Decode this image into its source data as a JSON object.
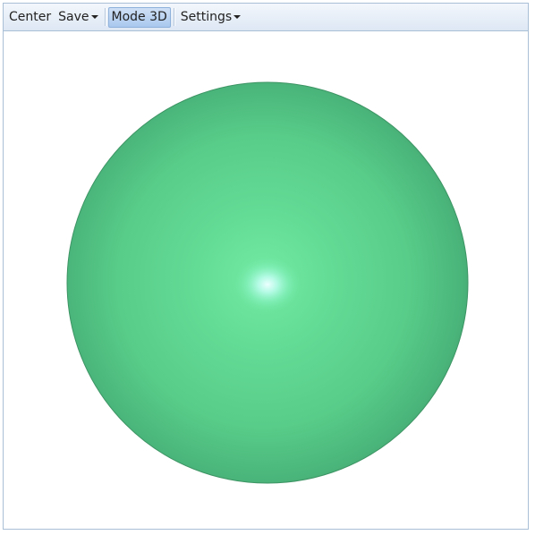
{
  "toolbar": {
    "center_label": "Center",
    "save_label": "Save",
    "mode_label": "Mode 3D",
    "settings_label": "Settings"
  },
  "scene": {
    "object": "sphere",
    "sphere_color": "#5fd08f",
    "background_color": "#ffffff",
    "toolbar_border_color": "#a9bfd6",
    "active_button_color": "#a9c8ee"
  }
}
